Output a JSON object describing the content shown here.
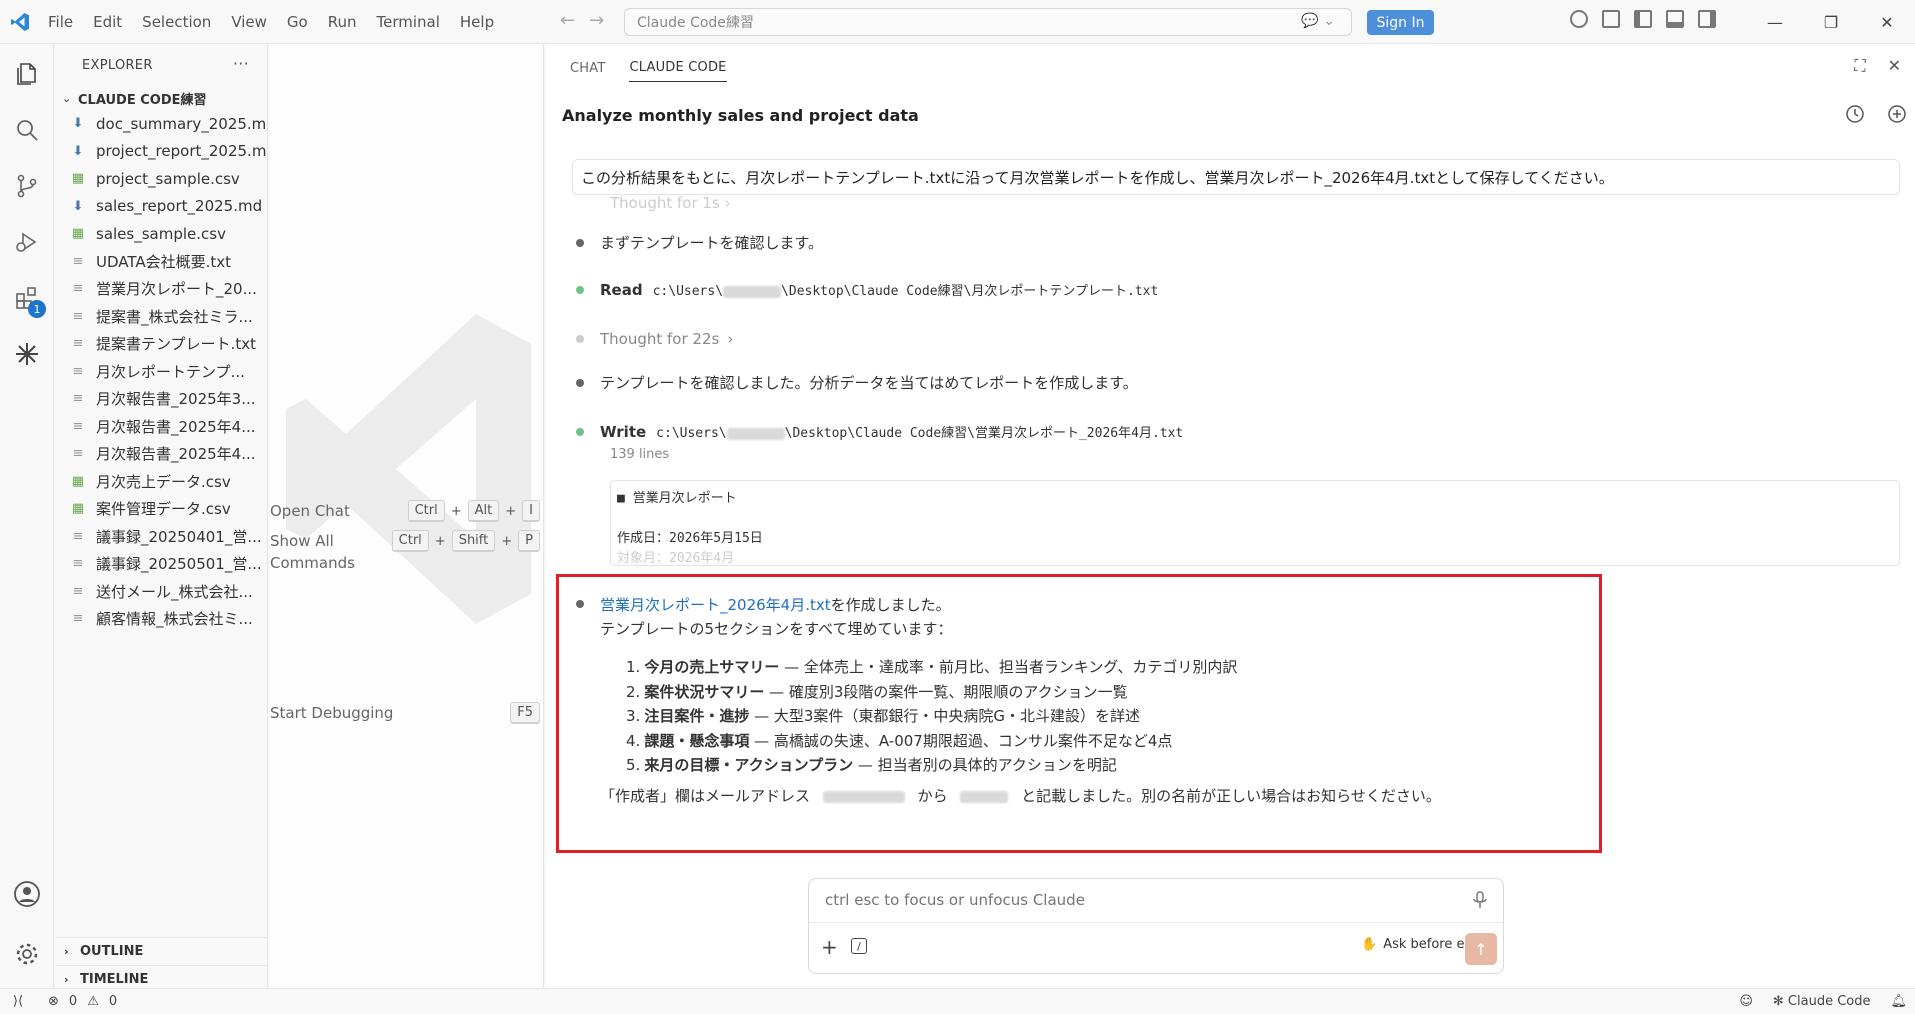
{
  "menu": [
    "File",
    "Edit",
    "Selection",
    "View",
    "Go",
    "Run",
    "Terminal",
    "Help"
  ],
  "command_center": "Claude Code練習",
  "signin_label": "Sign In",
  "activity": {
    "extensions_badge": "1"
  },
  "sidebar": {
    "header": "EXPLORER",
    "folder": "CLAUDE CODE練習",
    "files": [
      {
        "name": "doc_summary_2025.md",
        "type": "md"
      },
      {
        "name": "project_report_2025.md",
        "type": "md"
      },
      {
        "name": "project_sample.csv",
        "type": "csv"
      },
      {
        "name": "sales_report_2025.md",
        "type": "md"
      },
      {
        "name": "sales_sample.csv",
        "type": "csv"
      },
      {
        "name": "UDATA会社概要.txt",
        "type": "txt"
      },
      {
        "name": "営業月次レポート_20...",
        "type": "txt"
      },
      {
        "name": "提案書_株式会社ミラ...",
        "type": "txt"
      },
      {
        "name": "提案書テンプレート.txt",
        "type": "txt"
      },
      {
        "name": "月次レポートテンプ...",
        "type": "txt"
      },
      {
        "name": "月次報告書_2025年3...",
        "type": "txt"
      },
      {
        "name": "月次報告書_2025年4...",
        "type": "txt"
      },
      {
        "name": "月次報告書_2025年4...",
        "type": "txt"
      },
      {
        "name": "月次売上データ.csv",
        "type": "csv"
      },
      {
        "name": "案件管理データ.csv",
        "type": "csv"
      },
      {
        "name": "議事録_20250401_営...",
        "type": "txt"
      },
      {
        "name": "議事録_20250501_営...",
        "type": "txt"
      },
      {
        "name": "送付メール_株式会社...",
        "type": "txt"
      },
      {
        "name": "顧客情報_株式会社ミ...",
        "type": "txt"
      }
    ],
    "outline": "OUTLINE",
    "timeline": "TIMELINE"
  },
  "welcome": {
    "open_chat": {
      "label": "Open Chat",
      "keys": [
        "Ctrl",
        "Alt",
        "I"
      ]
    },
    "show_all_commands": {
      "label1": "Show All",
      "label2": "Commands",
      "keys": [
        "Ctrl",
        "Shift",
        "P"
      ]
    },
    "start_debugging": {
      "label": "Start Debugging",
      "keys": [
        "F5"
      ]
    }
  },
  "panel": {
    "tabs": [
      "CHAT",
      "CLAUDE CODE"
    ],
    "title": "Analyze monthly sales and project data",
    "user_message": "この分析結果をもとに、月次レポートテンプレート.txtに沿って月次営業レポートを作成し、営業月次レポート_2026年4月.txtとして保存してください。",
    "ghost_text": "Thought for 1s",
    "step1": "まずテンプレートを確認します。",
    "read": {
      "tool": "Read",
      "path_prefix": "c:\\Users\\",
      "path_suffix": "\\Desktop\\Claude Code練習\\月次レポートテンプレート.txt"
    },
    "thought": "Thought for 22s",
    "step2": "テンプレートを確認しました。分析データを当てはめてレポートを作成します。",
    "write": {
      "tool": "Write",
      "path_prefix": "c:\\Users\\",
      "path_suffix": "\\Desktop\\Claude Code練習\\営業月次レポート_2026年4月.txt"
    },
    "line_count": "139 lines",
    "preview": {
      "line1": "■ 営業月次レポート",
      "line2": "作成日：2026年5月15日",
      "line3": "対象月：2026年4月"
    },
    "result": {
      "link": "営業月次レポート_2026年4月.txt",
      "after_link": " を作成しました。",
      "line2": "テンプレートの5セクションをすべて埋めています：",
      "items": [
        {
          "n": "1.",
          "bold": "今月の売上サマリー",
          "rest": " — 全体売上・達成率・前月比、担当者ランキング、カテゴリ別内訳"
        },
        {
          "n": "2.",
          "bold": "案件状況サマリー",
          "rest": " — 確度別3段階の案件一覧、期限順のアクション一覧"
        },
        {
          "n": "3.",
          "bold": "注目案件・進捗",
          "rest": " — 大型3案件（東都銀行・中央病院G・北斗建設）を詳述"
        },
        {
          "n": "4.",
          "bold": "課題・懸念事項",
          "rest": " — 高橋誠の失速、A-007期限超過、コンサル案件不足など4点"
        },
        {
          "n": "5.",
          "bold": "来月の目標・アクションプラン",
          "rest": " — 担当者別の具体的アクションを明記"
        }
      ],
      "footer_a": "「作成者」欄はメールアドレス",
      "footer_b": "から",
      "footer_c": "と記載しました。別の名前が正しい場合はお知らせください。"
    },
    "input_placeholder": "ctrl esc to focus or unfocus Claude",
    "mode_label": "Ask before edits"
  },
  "status": {
    "errors": "0",
    "warnings": "0",
    "claude_code": "Claude Code"
  }
}
